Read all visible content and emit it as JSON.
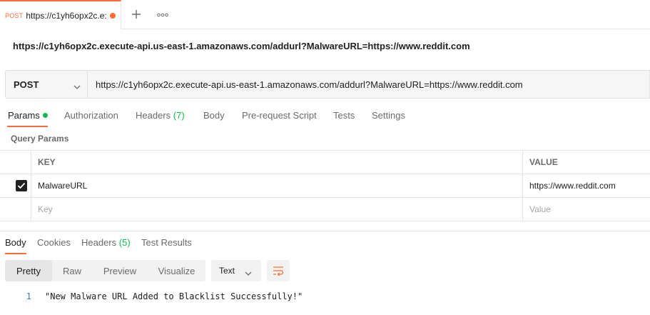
{
  "tabstrip": {
    "tab": {
      "method": "POST",
      "title": "https://c1yh6opx2c.e:"
    },
    "add_icon": "plus-icon",
    "more_icon": "more-icon"
  },
  "request": {
    "name": "https://c1yh6opx2c.execute-api.us-east-1.amazonaws.com/addurl?MalwareURL=https://www.reddit.com",
    "method": "POST",
    "url": "https://c1yh6opx2c.execute-api.us-east-1.amazonaws.com/addurl?MalwareURL=https://www.reddit.com"
  },
  "request_tabs": {
    "params": "Params",
    "authorization": "Authorization",
    "headers": "Headers",
    "headers_count": "(7)",
    "body": "Body",
    "prerequest": "Pre-request Script",
    "tests": "Tests",
    "settings": "Settings"
  },
  "query_params": {
    "title": "Query Params",
    "col_key": "KEY",
    "col_value": "VALUE",
    "row": {
      "key": "MalwareURL",
      "value": "https://www.reddit.com",
      "checked": true
    },
    "placeholder": {
      "key": "Key",
      "value": "Value"
    }
  },
  "response_tabs": {
    "body": "Body",
    "cookies": "Cookies",
    "headers": "Headers",
    "headers_count": "(5)",
    "test_results": "Test Results"
  },
  "format": {
    "pretty": "Pretty",
    "raw": "Raw",
    "preview": "Preview",
    "visualize": "Visualize",
    "language": "Text"
  },
  "response_body": {
    "line_number": "1",
    "text": "\"New Malware URL Added to Blacklist Successfully!\""
  },
  "colors": {
    "accent": "#ff6c37",
    "success": "#0cbb52",
    "line_number": "#2a7cc7"
  }
}
